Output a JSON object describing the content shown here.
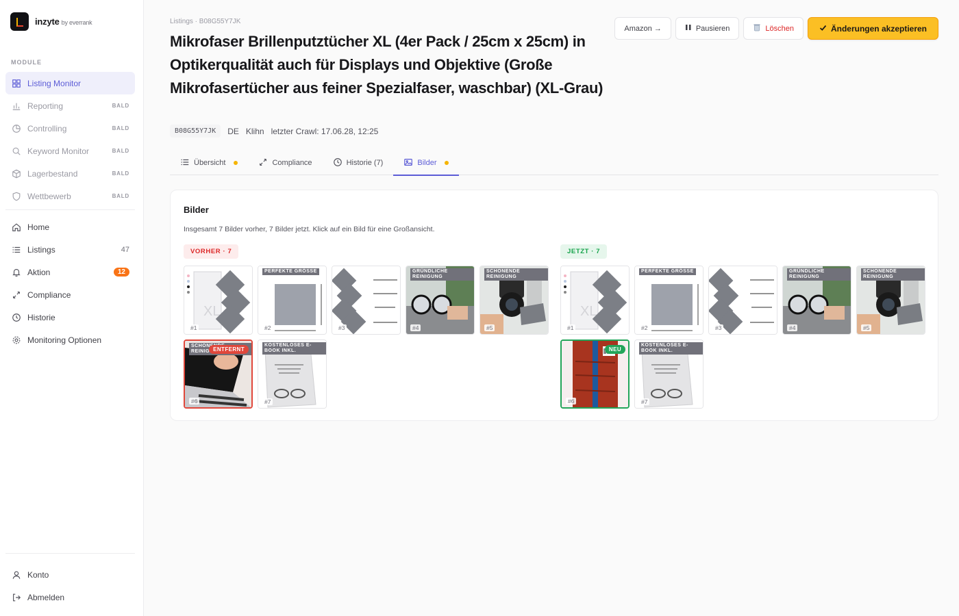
{
  "brand": {
    "name": "inzyte",
    "by": "by everrank"
  },
  "sidebar": {
    "section_label": "MODULE",
    "modules": [
      {
        "label": "Listing Monitor",
        "icon": "grid-icon",
        "active": true
      },
      {
        "label": "Reporting",
        "icon": "bar-chart-icon",
        "soon": "BALD"
      },
      {
        "label": "Controlling",
        "icon": "pie-chart-icon",
        "soon": "BALD"
      },
      {
        "label": "Keyword Monitor",
        "icon": "search-icon",
        "soon": "BALD"
      },
      {
        "label": "Lagerbestand",
        "icon": "box-icon",
        "soon": "BALD"
      },
      {
        "label": "Wettbewerb",
        "icon": "shield-icon",
        "soon": "BALD"
      }
    ],
    "nav": [
      {
        "label": "Home",
        "icon": "home-icon"
      },
      {
        "label": "Listings",
        "icon": "list-icon",
        "count": "47"
      },
      {
        "label": "Aktion",
        "icon": "bell-icon",
        "badge": "12"
      },
      {
        "label": "Compliance",
        "icon": "arrows-icon"
      },
      {
        "label": "Historie",
        "icon": "clock-icon"
      },
      {
        "label": "Monitoring Optionen",
        "icon": "gear-icon"
      }
    ],
    "footer": [
      {
        "label": "Konto",
        "icon": "user-icon"
      },
      {
        "label": "Abmelden",
        "icon": "logout-icon"
      }
    ]
  },
  "header": {
    "breadcrumb": "Listings · B08G55Y7JK",
    "title": "Mikrofaser Brillenputztücher XL (4er Pack / 25cm x 25cm) in Optikerqualität auch für Displays und Objektive (Große Mikrofasertücher aus feiner Spezialfaser, waschbar) (XL-Grau)",
    "asin": "B08G55Y7JK",
    "marketplace": "DE",
    "brand": "Klihn",
    "last_crawl": "letzter Crawl: 17.06.28, 12:25"
  },
  "actions": {
    "amazon": "Amazon →",
    "pause": "Pausieren",
    "delete": "Löschen",
    "accept": "Änderungen akzeptieren"
  },
  "tabs": [
    {
      "label": "Übersicht",
      "icon": "list-icon",
      "dot": true
    },
    {
      "label": "Compliance",
      "icon": "arrows-icon",
      "dot": false
    },
    {
      "label": "Historie (7)",
      "icon": "clock-icon",
      "dot": false
    },
    {
      "label": "Bilder",
      "icon": "image-icon",
      "dot": true,
      "active": true
    }
  ],
  "images_card": {
    "title": "Bilder",
    "description": "Insgesamt 7 Bilder vorher, 7 Bilder jetzt. Klick auf ein Bild für eine Großansicht.",
    "before_label": "VORHER · 7",
    "now_label": "JETZT · 7",
    "before": [
      {
        "idx": "#1",
        "kind": "box"
      },
      {
        "idx": "#2",
        "kind": "size",
        "hdr": "PERFEKTE GRÖSSE"
      },
      {
        "idx": "#3",
        "kind": "cloths"
      },
      {
        "idx": "#4",
        "kind": "glasses",
        "hdr": "GRÜNDLICHE REINIGUNG"
      },
      {
        "idx": "#5",
        "kind": "camera",
        "hdr": "SCHONENDE REINIGUNG"
      },
      {
        "idx": "#6",
        "kind": "laptop",
        "flag": "ENTFERNT",
        "hdr": "SCHONENDE REINIGUNG"
      },
      {
        "idx": "#7",
        "kind": "ebook",
        "hdr": "KOSTENLOSES E-BOOK INKL."
      }
    ],
    "now": [
      {
        "idx": "#1",
        "kind": "box"
      },
      {
        "idx": "#2",
        "kind": "size",
        "hdr": "PERFEKTE GRÖSSE"
      },
      {
        "idx": "#3",
        "kind": "cloths"
      },
      {
        "idx": "#4",
        "kind": "glasses",
        "hdr": "GRÜNDLICHE REINIGUNG"
      },
      {
        "idx": "#5",
        "kind": "camera",
        "hdr": "SCHONENDE REINIGUNG"
      },
      {
        "idx": "#6",
        "kind": "redbook",
        "flag": "NEU"
      },
      {
        "idx": "#7",
        "kind": "ebook",
        "hdr": "KOSTENLOSES E-BOOK INKL."
      }
    ]
  }
}
